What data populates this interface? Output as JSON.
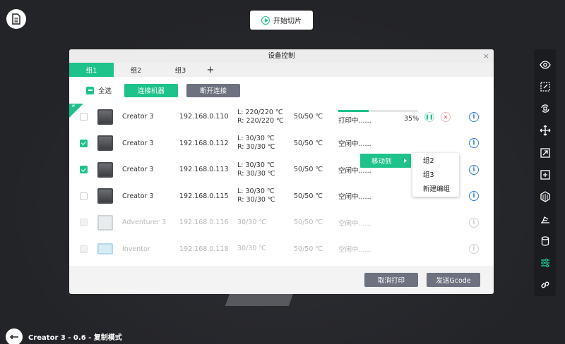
{
  "slice_button": {
    "label": "开始切片"
  },
  "status": {
    "text": "Creator 3 - 0.6 - 复制模式"
  },
  "dialog": {
    "title": "设备控制",
    "close": "×",
    "tabs": [
      "组1",
      "组2",
      "组3"
    ],
    "add_tab": "+",
    "select_all": "全选",
    "connect_label": "连接机器",
    "disconnect_label": "断开连接",
    "corner_tag": "≠",
    "cancel_print": "取消打印",
    "send_gcode": "发送Gcode"
  },
  "devices": [
    {
      "name": "Creator 3",
      "ip": "192.168.0.110",
      "nozzle_l": "L: 220/220 ℃",
      "nozzle_r": "R: 220/220 ℃",
      "bed": "50/50 ℃",
      "state": "打印中......",
      "progress": 0.38,
      "progress_text": "35%",
      "checked": false,
      "enabled": true
    },
    {
      "name": "Creator 3",
      "ip": "192.168.0.112",
      "nozzle_l": "L: 30/30 ℃",
      "nozzle_r": "R: 30/30 ℃",
      "bed": "50/50 ℃",
      "state": "空闲中......",
      "checked": true,
      "enabled": true
    },
    {
      "name": "Creator 3",
      "ip": "192.168.0.113",
      "nozzle_l": "L: 30/30 ℃",
      "nozzle_r": "R: 30/30 ℃",
      "bed": "50/50 ℃",
      "state": "空闲中......",
      "checked": true,
      "enabled": true
    },
    {
      "name": "Creator 3",
      "ip": "192.168.0.115",
      "nozzle_l": "L: 30/30 ℃",
      "nozzle_r": "R: 30/30 ℃",
      "bed": "50/50 ℃",
      "state": "空闲中......",
      "checked": false,
      "enabled": true
    },
    {
      "name": "Adventurer 3",
      "ip": "192.168.0.116",
      "nozzle": "30/30 ℃",
      "bed": "50/50 ℃",
      "state": "空闲中......",
      "checked": false,
      "enabled": false
    },
    {
      "name": "Inventor",
      "ip": "192.168.0.118",
      "nozzle": "30/30 ℃",
      "bed": "50/50 ℃",
      "state": "空闲中......",
      "checked": false,
      "enabled": false
    }
  ],
  "context_menu": {
    "move_to": "移动到",
    "submenu": [
      "组2",
      "组3",
      "新建编组"
    ]
  },
  "toolbar_icons": [
    "eye-icon",
    "select-icon",
    "rotate-icon",
    "move-icon",
    "scale-icon",
    "add-icon",
    "infill-icon",
    "support-icon",
    "cylinder-icon",
    "settings-sliders-icon",
    "link-icon"
  ],
  "colors": {
    "accent": "#1ec28b",
    "grey_button": "#6d7180",
    "info": "#2f7fd6"
  }
}
